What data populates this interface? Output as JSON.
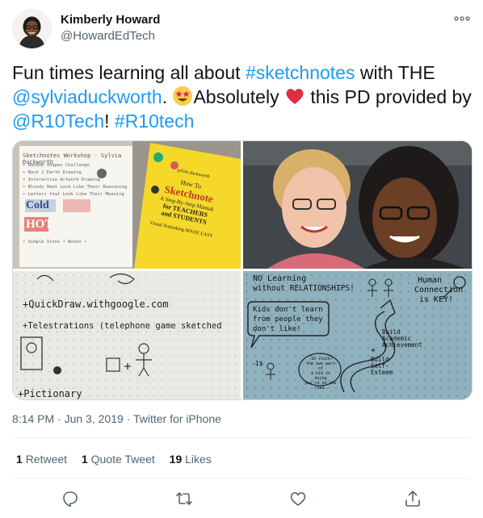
{
  "author": {
    "name": "Kimberly Howard",
    "handle": "@HowardEdTech"
  },
  "tweet": {
    "p1": "Fun times learning all about ",
    "hashtag1": "#sketchnotes",
    "p2": " with THE",
    "mention1": "@sylviaduckworth",
    "p3": ". ",
    "p4": "Absolutely ",
    "p5": " this PD provided by ",
    "mention2": "@R10Tech",
    "p6": "! ",
    "hashtag2": "#R10tech"
  },
  "media": {
    "t1": {
      "page_title": "Sketchnotes Workshop - Sylvia Duckworth",
      "page_lines": [
        "• Random Shapes Challenge",
        "• Back 2 Earth Drawing",
        "• Interactive Artwork Drawing",
        "• Bloody Heat Lock Like Their Reasoning",
        "• Letters that Look Like Their Meaning"
      ],
      "word_cold": "Cold",
      "word_hot": "HOT",
      "page_footer": "• Simple Icons • Books •",
      "book_author": "sylvia duckworth",
      "book_title_1": "How To",
      "book_title_2": "Sketchnote",
      "book_subtitle_1": "A Step-By-Step Manual",
      "book_subtitle_2": "for TEACHERS",
      "book_subtitle_3": "and STUDENTS",
      "book_footer": "Visual Notetaking MADE EASY"
    },
    "t3": {
      "line1": "+QuickDraw.withgoogle.com",
      "line2": "+Telestrations (telephone game sketched",
      "line3": "+Pictionary"
    },
    "t4": {
      "l1": "NO Learning",
      "l2": "without RELATIONSHIPS!",
      "l3": "Human",
      "l4": "Connection",
      "l5": "is KEY!",
      "bubble1": "Kids don't learn",
      "bubble2": "from people they",
      "bubble3": "don't like!",
      "build1": "Build",
      "build2": "Academic",
      "build3": "Achievement",
      "plus": "+",
      "build4": "Build",
      "build5": "Self-",
      "build6": "Esteem",
      "small1": "-10 stuck?",
      "small2": "the ave part of",
      "small3": "a kid is doing",
      "small4": "you're on the",
      "small5": "road.",
      "money": "-1$"
    }
  },
  "meta": {
    "time": "8:14 PM",
    "sep": " · ",
    "date": "Jun 3, 2019",
    "source": "Twitter for iPhone"
  },
  "stats": {
    "retweets_count": "1",
    "retweets_label": "Retweet",
    "quotes_count": "1",
    "quotes_label": "Quote Tweet",
    "likes_count": "19",
    "likes_label": "Likes"
  },
  "colors": {
    "link": "#1d9bf0",
    "heart": "#e0245e",
    "muted": "#536471"
  }
}
